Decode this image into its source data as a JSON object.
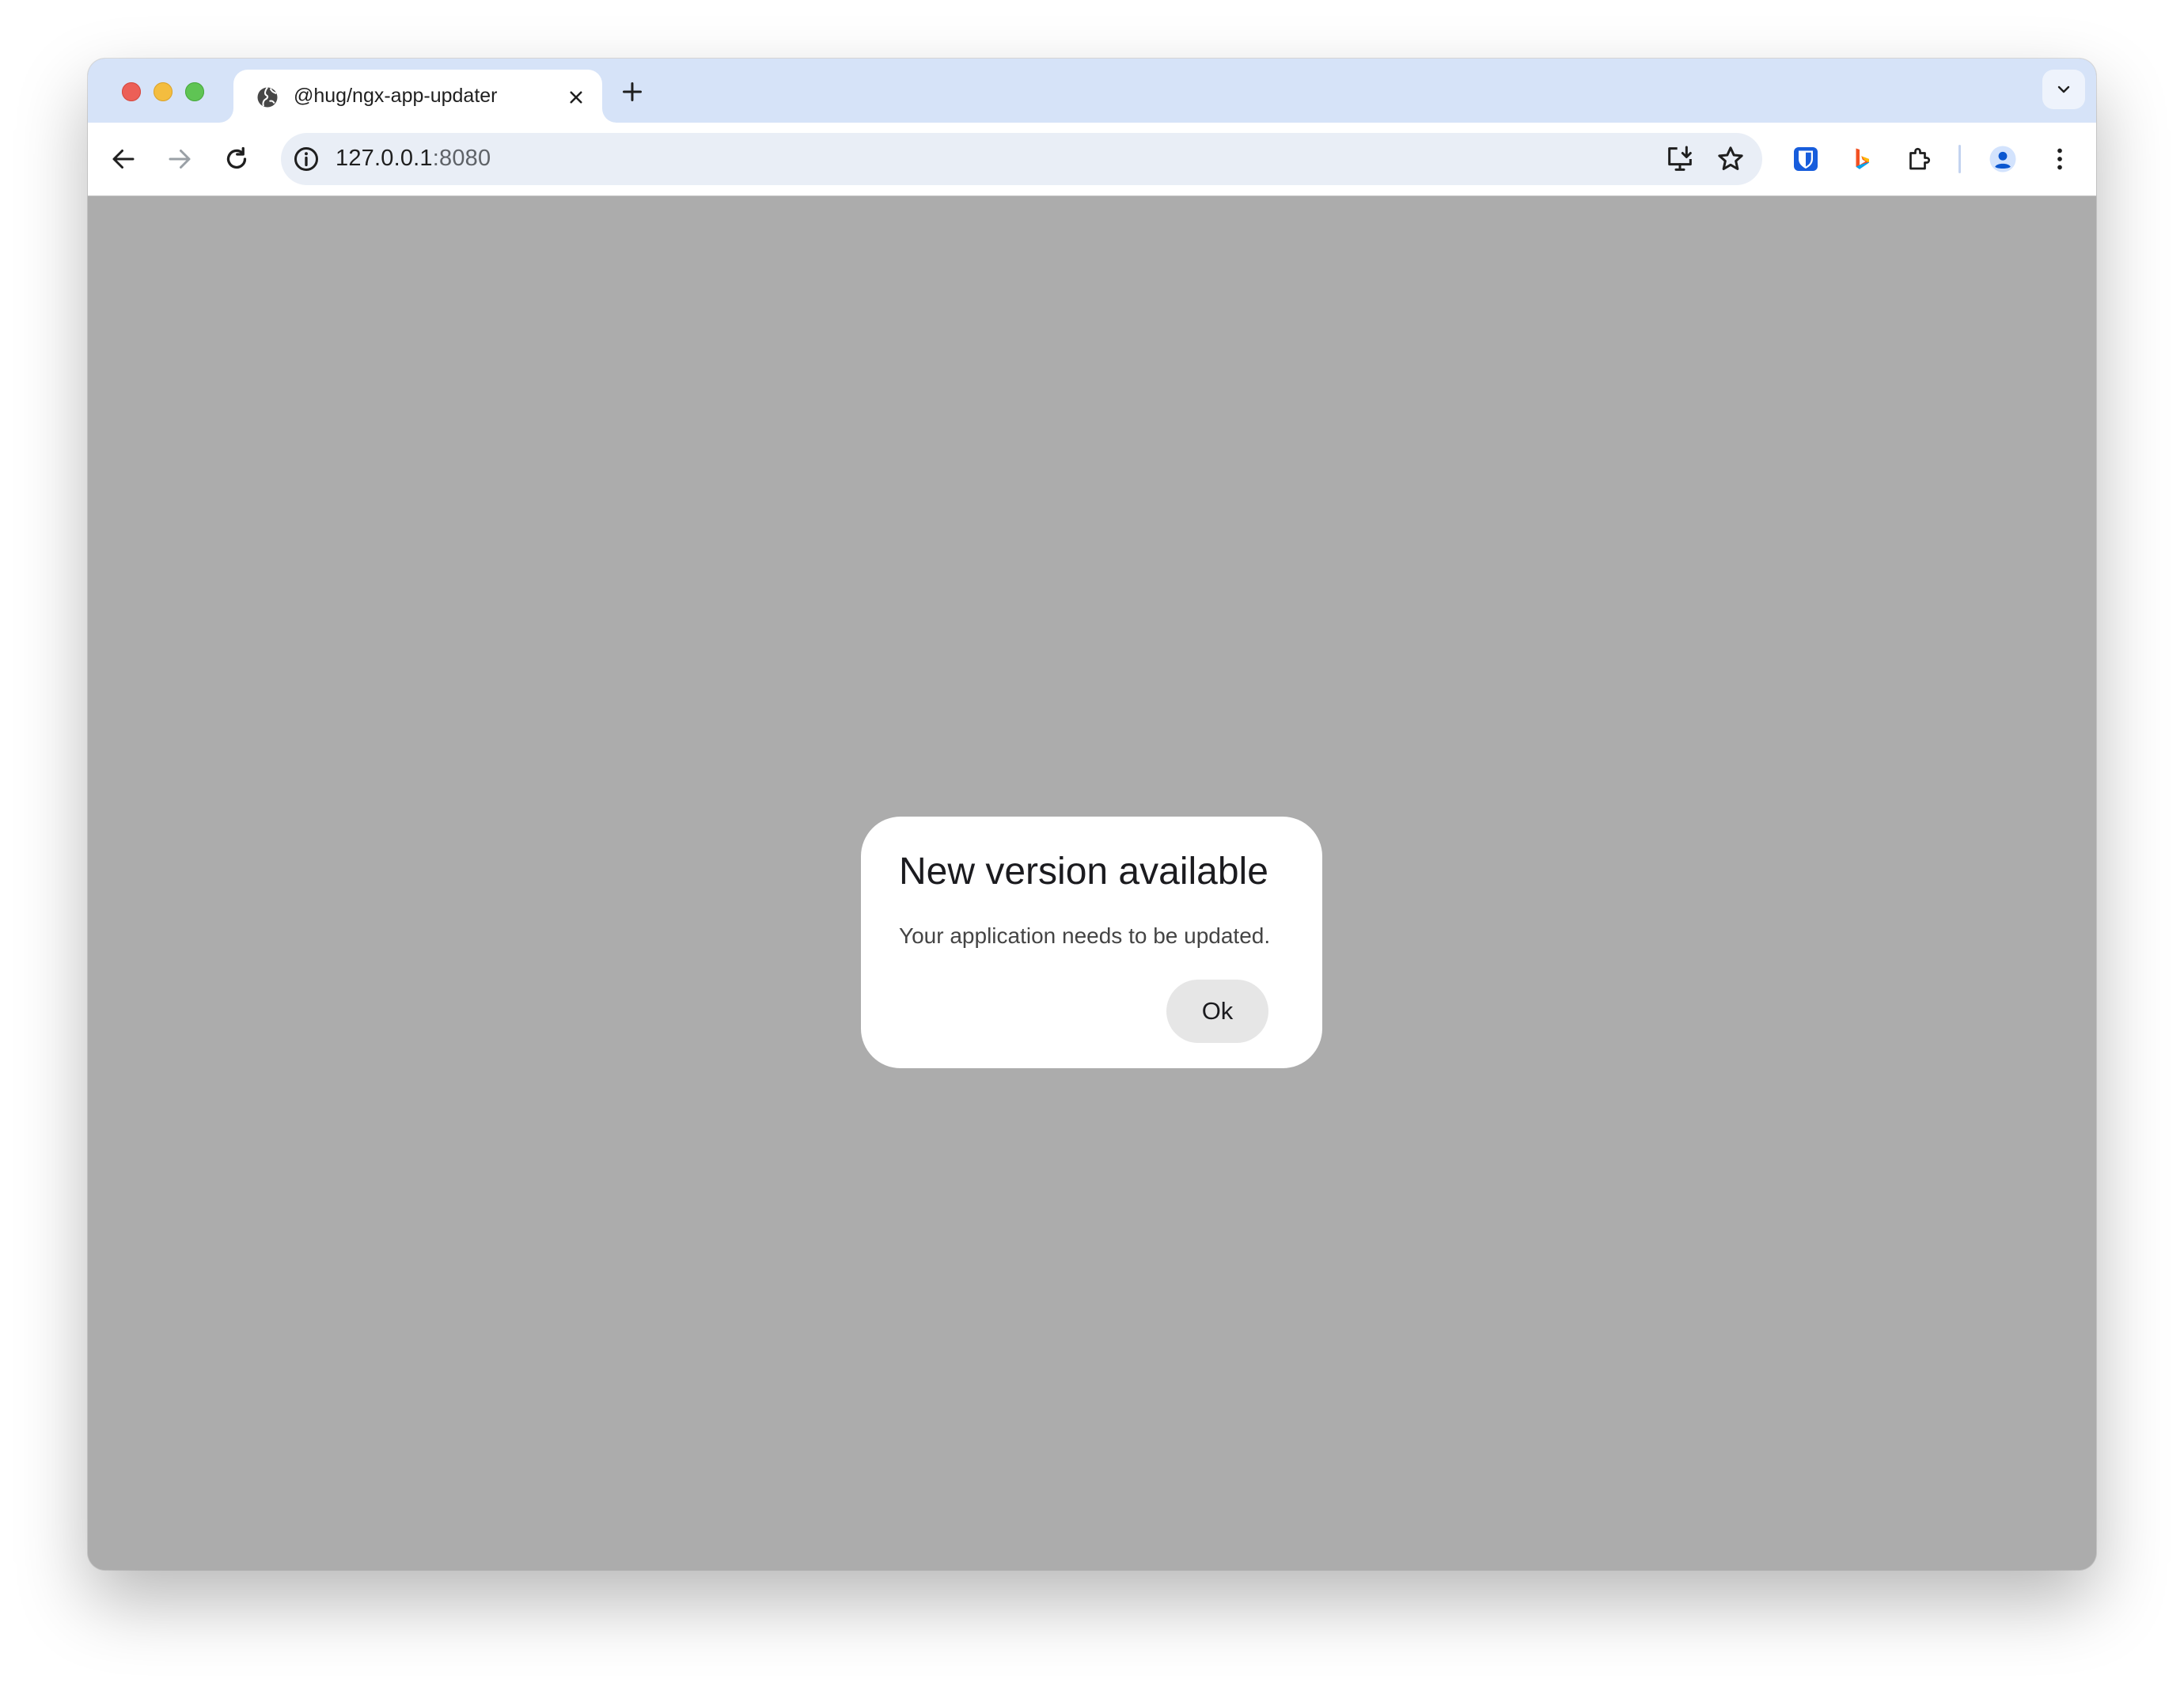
{
  "tab": {
    "title": "@hug/ngx-app-updater"
  },
  "address_bar": {
    "host": "127.0.0.1",
    "port": ":8080"
  },
  "toolbar": {
    "icons": [
      "back-icon",
      "forward-icon",
      "reload-icon",
      "site-info-icon",
      "install-app-icon",
      "bookmark-star-icon",
      "bitwarden-icon",
      "bing-icon",
      "extensions-icon",
      "profile-icon",
      "menu-icon"
    ]
  },
  "dialog": {
    "title": "New version available",
    "message": "Your application needs to be updated.",
    "ok_label": "Ok"
  },
  "colors": {
    "tab_strip": "#d6e3f8",
    "page_backdrop": "#acacac",
    "dialog_bg": "#ffffff",
    "ok_button_bg": "#e6e6e6"
  }
}
